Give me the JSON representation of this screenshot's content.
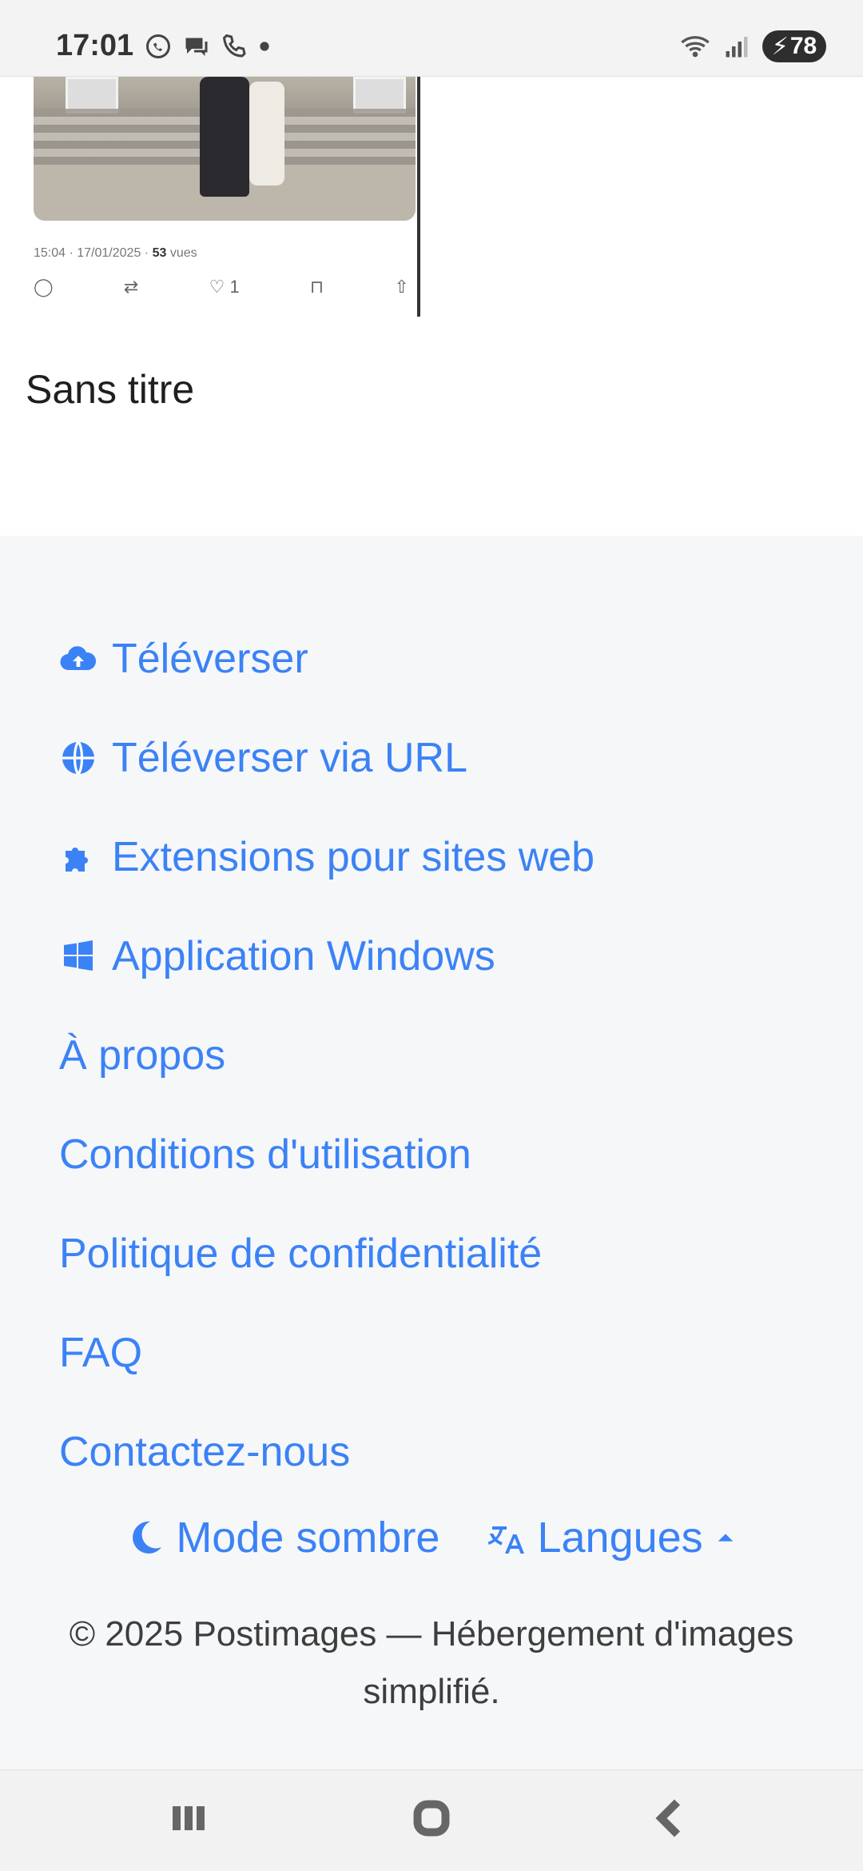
{
  "status_bar": {
    "time": "17:01",
    "icons_left": [
      "whatsapp-icon",
      "chat-bubble-icon",
      "wifi-calling-icon",
      "dot"
    ],
    "icons_right": [
      "wifi-icon",
      "signal-icon"
    ],
    "battery": "78"
  },
  "tweet": {
    "meta_time": "15:04 · 17/01/2025 ·",
    "views_count": "53",
    "views_label": "vues",
    "likes": "1"
  },
  "image_caption": "Sans titre",
  "footer": {
    "links": [
      {
        "label": "Téléverser",
        "icon": "cloud-upload-icon"
      },
      {
        "label": "Téléverser via URL",
        "icon": "globe-icon"
      },
      {
        "label": "Extensions pour sites web",
        "icon": "puzzle-icon"
      },
      {
        "label": "Application Windows",
        "icon": "windows-icon"
      },
      {
        "label": "À propos"
      },
      {
        "label": "Conditions d'utilisation"
      },
      {
        "label": "Politique de confidentialité"
      },
      {
        "label": "FAQ"
      },
      {
        "label": "Contactez-nous"
      }
    ],
    "dark_mode_label": "Mode sombre",
    "languages_label": "Langues",
    "copyright": "© 2025 Postimages — Hébergement d'images simplifié."
  },
  "colors": {
    "link": "#3b82f6",
    "footer_bg": "#f6f7f9"
  }
}
